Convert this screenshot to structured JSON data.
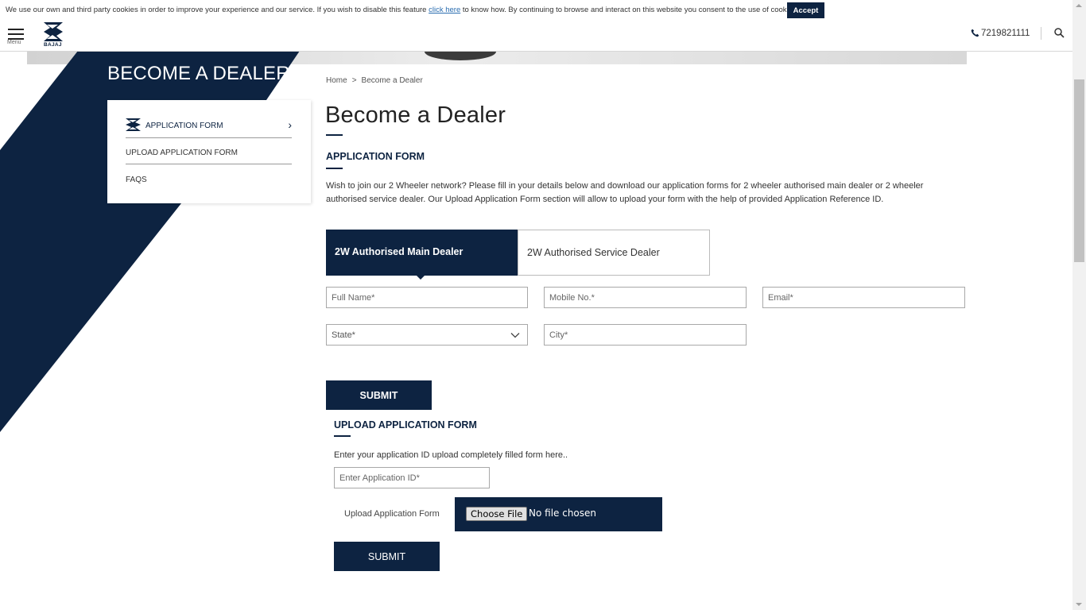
{
  "cookie_bar": {
    "text_before": "We use our own and third party cookies in order to improve your experience and our service. If you wish to disable this feature ",
    "link": "click here",
    "text_after": " to know how. By continuing to browse and interact on this website you consent to the use of cookies.",
    "accept_label": "Accept"
  },
  "header": {
    "menu_label": "Menu",
    "logo_text": "BAJAJ",
    "phone": "7219821111",
    "phone_icon": "phone-icon",
    "search_icon": "search-icon"
  },
  "sidebar": {
    "banner_title": "BECOME A DEALER",
    "items": [
      {
        "label": "APPLICATION FORM",
        "active": true
      },
      {
        "label": "UPLOAD APPLICATION FORM"
      },
      {
        "label": "FAQS"
      }
    ]
  },
  "breadcrumb": [
    "Home",
    ">",
    "Become a Dealer"
  ],
  "main": {
    "title": "Become a Dealer",
    "section_heading": "APPLICATION FORM",
    "description": "Wish to join our 2 Wheeler network? Please fill in your details below and download our application forms for 2 wheeler authorised main dealer or 2 wheeler authorised service dealer. Our Upload Application Form section will allow to upload your form with the help of provided Application Reference ID.",
    "tabs": [
      {
        "label": "2W Authorised Main Dealer",
        "active": true
      },
      {
        "label": "2W Authorised Service Dealer"
      }
    ],
    "fields": {
      "full_name": "Full Name*",
      "mobile": "Mobile No.*",
      "email": "Email*",
      "state": "State*",
      "city": "City*"
    },
    "submit_label": "SUBMIT"
  },
  "upload": {
    "heading": "UPLOAD APPLICATION FORM",
    "description": "Enter your application ID upload completely filled form here..",
    "app_id_placeholder": "Enter Application ID*",
    "upload_label": "Upload Application Form",
    "choose_file": "Choose File",
    "no_file": "No file chosen",
    "submit_label": "SUBMIT"
  },
  "colors": {
    "brand_navy": "#0d2341",
    "link": "#2a6db0"
  }
}
